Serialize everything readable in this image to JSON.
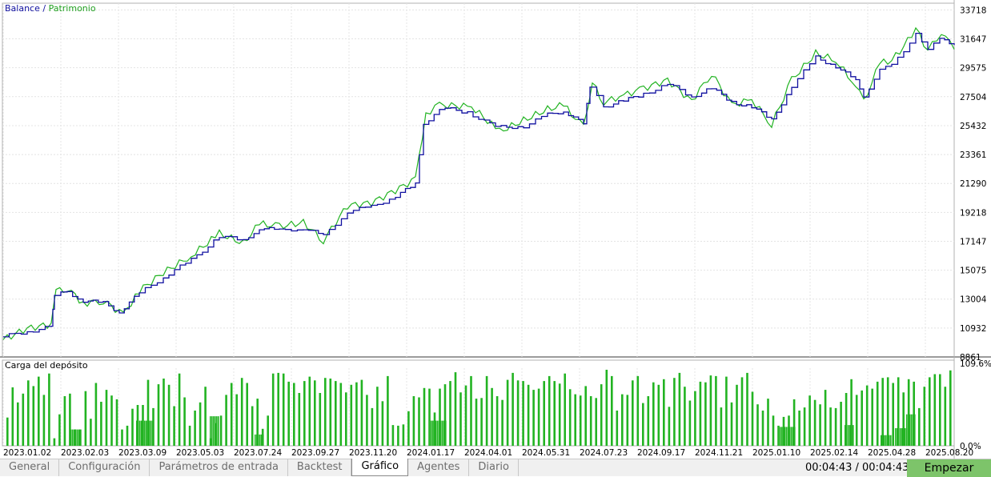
{
  "legend": {
    "balance": "Balance",
    "separator": " / ",
    "equity": "Patrimonio"
  },
  "load_title": "Carga del depósito",
  "colors": {
    "balance": "#1010a0",
    "equity": "#22b322",
    "bars": "#22b322",
    "grid": "#e4e4e4"
  },
  "chart_data": [
    {
      "type": "line",
      "series": [
        {
          "name": "Balance"
        },
        {
          "name": "Patrimonio"
        }
      ],
      "y_ticks": [
        "33718",
        "31647",
        "29575",
        "27504",
        "25432",
        "23361",
        "21290",
        "19218",
        "17147",
        "15075",
        "13004",
        "10932",
        "8861"
      ],
      "ylim": [
        8861,
        34200
      ],
      "x_ticks": [
        "2023.01.02",
        "2023.02.03",
        "2023.03.09",
        "2023.05.03",
        "2023.07.24",
        "2023.09.27",
        "2023.11.20",
        "2024.01.17",
        "2024.04.01",
        "2024.05.31",
        "2024.07.23",
        "2024.09.17",
        "2024.11.21",
        "2025.01.10",
        "2025.02.14",
        "2025.04.28",
        "2025.08.20"
      ],
      "balance": [
        [
          0,
          10300
        ],
        [
          30,
          10700
        ],
        [
          60,
          11000
        ],
        [
          64,
          13300
        ],
        [
          80,
          13500
        ],
        [
          100,
          12900
        ],
        [
          125,
          12700
        ],
        [
          145,
          12100
        ],
        [
          170,
          13400
        ],
        [
          200,
          14600
        ],
        [
          235,
          15800
        ],
        [
          270,
          17500
        ],
        [
          300,
          17200
        ],
        [
          320,
          18100
        ],
        [
          345,
          17900
        ],
        [
          375,
          18100
        ],
        [
          400,
          17500
        ],
        [
          430,
          19300
        ],
        [
          460,
          19600
        ],
        [
          490,
          20400
        ],
        [
          515,
          21200
        ],
        [
          525,
          25500
        ],
        [
          545,
          26700
        ],
        [
          580,
          26400
        ],
        [
          615,
          25300
        ],
        [
          650,
          25400
        ],
        [
          680,
          26200
        ],
        [
          700,
          26500
        ],
        [
          725,
          25500
        ],
        [
          733,
          28300
        ],
        [
          750,
          26800
        ],
        [
          775,
          27200
        ],
        [
          800,
          27700
        ],
        [
          830,
          28400
        ],
        [
          860,
          27500
        ],
        [
          885,
          28100
        ],
        [
          910,
          27100
        ],
        [
          935,
          26800
        ],
        [
          960,
          25800
        ],
        [
          985,
          28300
        ],
        [
          1015,
          30300
        ],
        [
          1040,
          29700
        ],
        [
          1065,
          28600
        ],
        [
          1075,
          27400
        ],
        [
          1095,
          29600
        ],
        [
          1110,
          29800
        ],
        [
          1125,
          30600
        ],
        [
          1140,
          32100
        ],
        [
          1155,
          31000
        ],
        [
          1170,
          31600
        ],
        [
          1188,
          31200
        ]
      ],
      "equity": [
        [
          0,
          10100
        ],
        [
          30,
          10900
        ],
        [
          60,
          11200
        ],
        [
          66,
          13600
        ],
        [
          80,
          13800
        ],
        [
          100,
          12700
        ],
        [
          125,
          12900
        ],
        [
          150,
          11900
        ],
        [
          170,
          13600
        ],
        [
          200,
          14900
        ],
        [
          235,
          16100
        ],
        [
          270,
          17700
        ],
        [
          300,
          17000
        ],
        [
          320,
          18400
        ],
        [
          345,
          18200
        ],
        [
          375,
          18500
        ],
        [
          400,
          17200
        ],
        [
          430,
          19700
        ],
        [
          460,
          19900
        ],
        [
          490,
          20800
        ],
        [
          515,
          21600
        ],
        [
          528,
          26300
        ],
        [
          545,
          26900
        ],
        [
          585,
          26800
        ],
        [
          620,
          25000
        ],
        [
          650,
          25800
        ],
        [
          680,
          26600
        ],
        [
          700,
          26900
        ],
        [
          725,
          25300
        ],
        [
          736,
          28500
        ],
        [
          750,
          27100
        ],
        [
          775,
          27600
        ],
        [
          800,
          28100
        ],
        [
          830,
          28700
        ],
        [
          860,
          27200
        ],
        [
          885,
          29200
        ],
        [
          910,
          26900
        ],
        [
          935,
          27300
        ],
        [
          960,
          25500
        ],
        [
          985,
          28700
        ],
        [
          1015,
          30600
        ],
        [
          1040,
          30100
        ],
        [
          1065,
          28300
        ],
        [
          1075,
          27100
        ],
        [
          1095,
          29900
        ],
        [
          1110,
          30100
        ],
        [
          1125,
          31100
        ],
        [
          1140,
          32400
        ],
        [
          1155,
          30800
        ],
        [
          1172,
          32200
        ],
        [
          1188,
          30900
        ]
      ]
    },
    {
      "type": "bar",
      "title": "Carga del depósito",
      "ylim": [
        0,
        109.6
      ],
      "y_ticks": [
        "109.6%",
        "0.0%"
      ],
      "values": [
        45,
        93,
        69,
        83,
        104,
        95,
        110,
        81,
        115,
        12,
        50,
        79,
        83,
        26,
        26,
        87,
        43,
        100,
        70,
        89,
        80,
        74,
        26,
        32,
        59,
        65,
        65,
        105,
        60,
        98,
        107,
        97,
        63,
        115,
        77,
        32,
        56,
        69,
        94,
        12,
        36,
        48,
        81,
        100,
        82,
        108,
        100,
        63,
        75,
        27,
        48,
        115,
        116,
        115,
        102,
        100,
        84,
        103,
        110,
        104,
        84,
        108,
        107,
        103,
        100,
        85,
        97,
        101,
        105,
        81,
        60,
        94,
        71,
        111,
        33,
        32,
        34,
        55,
        79,
        77,
        92,
        91,
        53,
        91,
        98,
        103,
        117,
        85,
        96,
        111,
        75,
        76,
        111,
        92,
        79,
        73,
        105,
        116,
        104,
        103,
        97,
        89,
        91,
        103,
        111,
        103,
        99,
        115,
        90,
        82,
        80,
        95,
        79,
        76,
        98,
        121,
        111,
        56,
        82,
        81,
        104,
        111,
        68,
        79,
        101,
        97,
        106,
        62,
        108,
        116,
        94,
        72,
        87,
        102,
        101,
        112,
        111,
        61,
        110,
        69,
        97,
        109,
        116,
        86,
        66,
        56,
        75,
        48,
        32,
        46,
        48,
        74,
        56,
        61,
        80,
        73,
        66,
        89,
        61,
        60,
        70,
        84,
        106,
        81,
        88,
        96,
        91,
        102,
        108,
        109,
        100,
        109,
        85,
        106,
        102,
        60,
        94,
        109,
        114,
        114,
        94,
        120
      ],
      "groups": [
        {
          "start": 12,
          "values": [
            26,
            26,
            26
          ]
        },
        {
          "start": 41,
          "values": [
            48,
            81,
            100,
            82
          ]
        },
        {
          "start": 52,
          "values": [
            48,
            48,
            48
          ]
        }
      ]
    }
  ]
}
